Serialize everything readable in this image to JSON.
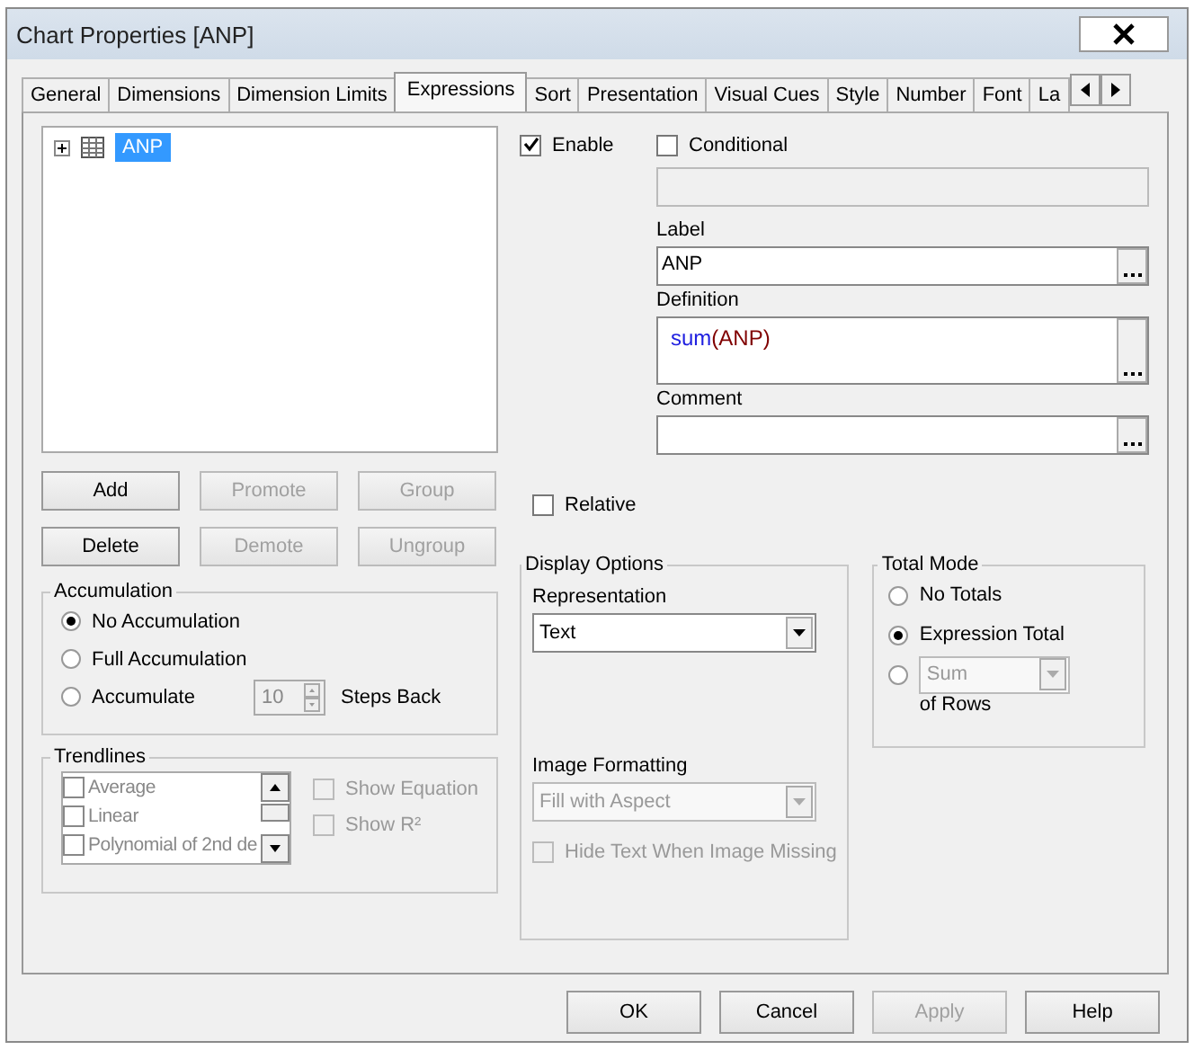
{
  "window": {
    "title": "Chart Properties [ANP]"
  },
  "tabs": [
    {
      "label": "General",
      "selected": false
    },
    {
      "label": "Dimensions",
      "selected": false
    },
    {
      "label": "Dimension Limits",
      "selected": false
    },
    {
      "label": "Expressions",
      "selected": true
    },
    {
      "label": "Sort",
      "selected": false
    },
    {
      "label": "Presentation",
      "selected": false
    },
    {
      "label": "Visual Cues",
      "selected": false
    },
    {
      "label": "Style",
      "selected": false
    },
    {
      "label": "Number",
      "selected": false
    },
    {
      "label": "Font",
      "selected": false
    },
    {
      "label": "La",
      "selected": false
    }
  ],
  "expression_tree": [
    {
      "label": "ANP",
      "selected": true,
      "expanded": false
    }
  ],
  "tree_buttons": [
    {
      "label": "Add",
      "disabled": false
    },
    {
      "label": "Promote",
      "disabled": true
    },
    {
      "label": "Group",
      "disabled": true
    },
    {
      "label": "Delete",
      "disabled": false
    },
    {
      "label": "Demote",
      "disabled": true
    },
    {
      "label": "Ungroup",
      "disabled": true
    }
  ],
  "accumulation": {
    "title": "Accumulation",
    "options": [
      {
        "label": "No Accumulation",
        "selected": true
      },
      {
        "label": "Full Accumulation",
        "selected": false
      },
      {
        "label": "Accumulate",
        "selected": false
      }
    ],
    "steps": "10",
    "steps_label": "Steps Back"
  },
  "trendlines": {
    "title": "Trendlines",
    "items": [
      {
        "label": "Average",
        "checked": false
      },
      {
        "label": "Linear",
        "checked": false
      },
      {
        "label": "Polynomial of 2nd de",
        "checked": false
      }
    ],
    "options": [
      {
        "label": "Show Equation",
        "checked": false,
        "disabled": true
      },
      {
        "label": "Show R²",
        "checked": false,
        "disabled": true
      }
    ]
  },
  "enable": {
    "label": "Enable",
    "checked": true
  },
  "conditional": {
    "label": "Conditional",
    "checked": false
  },
  "label_field": {
    "label": "Label",
    "value": "ANP"
  },
  "definition": {
    "label": "Definition",
    "tokens": [
      {
        "text": "sum",
        "kind": "function"
      },
      {
        "text": "(ANP)",
        "kind": "field"
      }
    ]
  },
  "comment": {
    "label": "Comment"
  },
  "relative": {
    "label": "Relative",
    "checked": false
  },
  "display_options": {
    "title": "Display Options",
    "representation_label": "Representation",
    "representation": "Text",
    "image_formatting_label": "Image Formatting",
    "image_formatting": "Fill with Aspect",
    "hide_text": {
      "label": "Hide Text When Image Missing",
      "checked": false,
      "disabled": true
    }
  },
  "total_mode": {
    "title": "Total Mode",
    "options": [
      {
        "label": "No Totals",
        "selected": false
      },
      {
        "label": "Expression Total",
        "selected": true
      },
      {
        "selected": false
      }
    ],
    "aggregation": "Sum",
    "suffix": "of Rows"
  },
  "buttons": [
    {
      "label": "OK",
      "disabled": false
    },
    {
      "label": "Cancel",
      "disabled": false
    },
    {
      "label": "Apply",
      "disabled": true
    },
    {
      "label": "Help",
      "disabled": false
    }
  ]
}
